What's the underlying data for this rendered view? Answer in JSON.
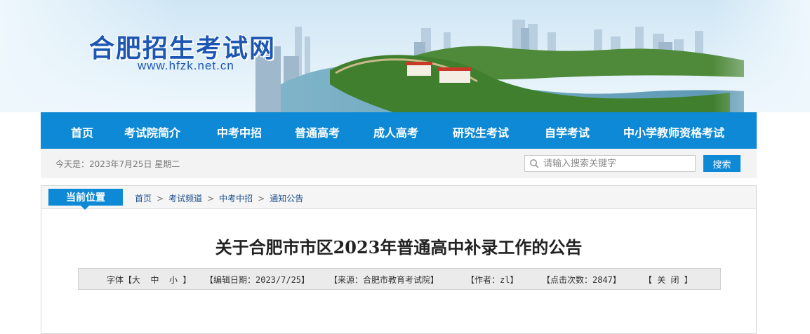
{
  "site": {
    "title": "合肥招生考试网",
    "url": "www.hfzk.net.cn"
  },
  "nav": {
    "items": [
      {
        "label": "首页"
      },
      {
        "label": "考试院简介"
      },
      {
        "label": "中考中招"
      },
      {
        "label": "普通高考"
      },
      {
        "label": "成人高考"
      },
      {
        "label": "研究生考试"
      },
      {
        "label": "自学考试"
      },
      {
        "label": "中小学教师资格考试"
      }
    ]
  },
  "infobar": {
    "date_text": "今天是：2023年7月25日 星期二",
    "search_placeholder": "请输入搜索关键字",
    "search_button": "搜索"
  },
  "breadcrumb": {
    "tag": "当前位置",
    "items": [
      "首页",
      "考试频道",
      "中考中招",
      "通知公告"
    ]
  },
  "article": {
    "title": "关于合肥市市区2023年普通高中补录工作的公告",
    "meta": {
      "font_label": "字体【",
      "font_large": "大",
      "font_medium": "中",
      "font_small": "小",
      "font_close": "】",
      "edit_date": "【编辑日期：2023/7/25】",
      "source": "【来源：合肥市教育考试院】",
      "author": "【作者：zl】",
      "clicks": "【点击次数：2847】",
      "close_label": "【 关 闭 】"
    }
  },
  "colors": {
    "nav_bg": "#0e89d5",
    "title_blue": "#1d57b3"
  }
}
